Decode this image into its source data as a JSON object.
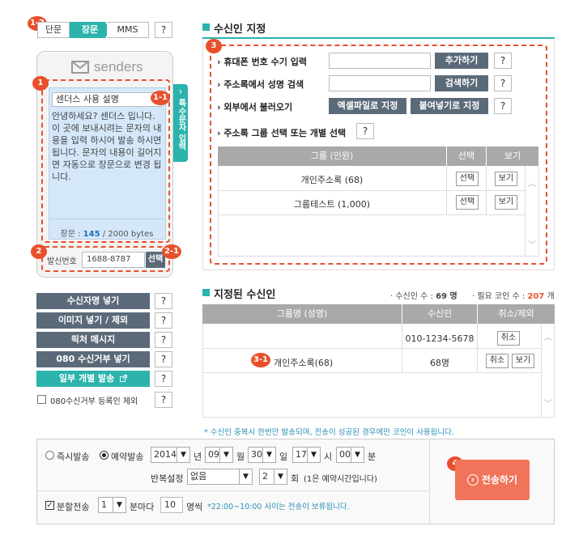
{
  "badges": {
    "b1_2": "1-2",
    "b1": "1",
    "b1_1": "1-1",
    "b2": "2",
    "b2_1": "2-1",
    "b3": "3",
    "b3_1": "3-1",
    "b4": "4"
  },
  "msg_type_tabs": [
    "단문",
    "장문",
    "MMS"
  ],
  "msg_type_selected": "장문",
  "help": "?",
  "phone": {
    "logo": "senders",
    "title": "센더스 사용 설명",
    "body": "안녕하세요? 센더스 입니다. 이 곳에 보내시려는 문자의 내용을 입력 하시어 발송 하시면 됩니다. 문자의 내용이 길어지면 자동으로 장문으로 변경 됩니다.",
    "counter_label": "장문 : ",
    "counter_value": "145",
    "counter_suffix": " / 2000 bytes",
    "special_chars_tab": "특수문자 입력",
    "special_chars_arrow": "›",
    "sender_label": "발신번호",
    "sender_number": "1688-8787",
    "sender_select": "선택"
  },
  "left_buttons": [
    "수신자명 넣기",
    "이미지 넣기 / 제외",
    "픽처 메시지",
    "080 수신거부 넣기",
    "일부 개별 발송"
  ],
  "left_checkbox": "080수신거부 등록인 제외",
  "recipient_section": {
    "title": "수신인 지정",
    "rows": [
      {
        "label": "휴대폰 번호 수기 입력",
        "button": "추가하기"
      },
      {
        "label": "주소록에서 성명 검색",
        "button": "검색하기"
      },
      {
        "label": "외부에서 불러오기",
        "button": "엑셀파일로 지정",
        "button2": "붙여넣기로 지정"
      },
      {
        "label": "주소록 그룹 선택 또는 개별 선택"
      }
    ],
    "table_headers": [
      "그룹 (인원)",
      "선택",
      "보기"
    ],
    "table_rows": [
      {
        "group": "개인주소록 (68)",
        "select": "선택",
        "view": "보기"
      },
      {
        "group": "그룹테스트 (1,000)",
        "select": "선택",
        "view": "보기"
      }
    ]
  },
  "assigned_section": {
    "title": "지정된 수신인",
    "count_label": "· 수신인 수 : ",
    "count_value": "69 명",
    "coin_label": "· 필요 코인 수 : ",
    "coin_value": "207",
    "coin_suffix": " 개",
    "headers": [
      "그룹명 (성명)",
      "수신인",
      "취소/제외"
    ],
    "rows": [
      {
        "name": "",
        "recipient": "010-1234-5678",
        "cancel": "취소"
      },
      {
        "name": "개인주소록(68)",
        "recipient": "68명",
        "cancel": "취소",
        "view": "보기"
      }
    ],
    "note": "* 수신인 중복시 한번만 발송되며, 전송이 성공된 경우에만 코인이 사용됩니다."
  },
  "schedule": {
    "instant": "즉시발송",
    "reserve": "예약발송",
    "year": "2014",
    "year_unit": "년",
    "month": "09",
    "month_unit": "월",
    "day": "30",
    "day_unit": "일",
    "hour": "17",
    "hour_unit": "시",
    "minute": "00",
    "minute_unit": "분",
    "repeat_label": "반복설정",
    "repeat_value": "없음",
    "repeat_count": "2",
    "repeat_unit": "회",
    "repeat_note": "(1은 예약시간입니다)",
    "split_label": "분할전송",
    "split_minutes": "1",
    "split_minutes_unit": "분마다",
    "split_count": "10",
    "split_count_unit": "명씩",
    "split_note": "*22:00~10:00 사이는 전송이 보류됩니다."
  },
  "send_button": "전송하기",
  "send_icon": "›",
  "colors": {
    "accent": "#2bb3ac",
    "badge": "#e8502b",
    "send": "#f0735a",
    "dark_btn": "#5b6a79",
    "coin": "#e8502b"
  }
}
